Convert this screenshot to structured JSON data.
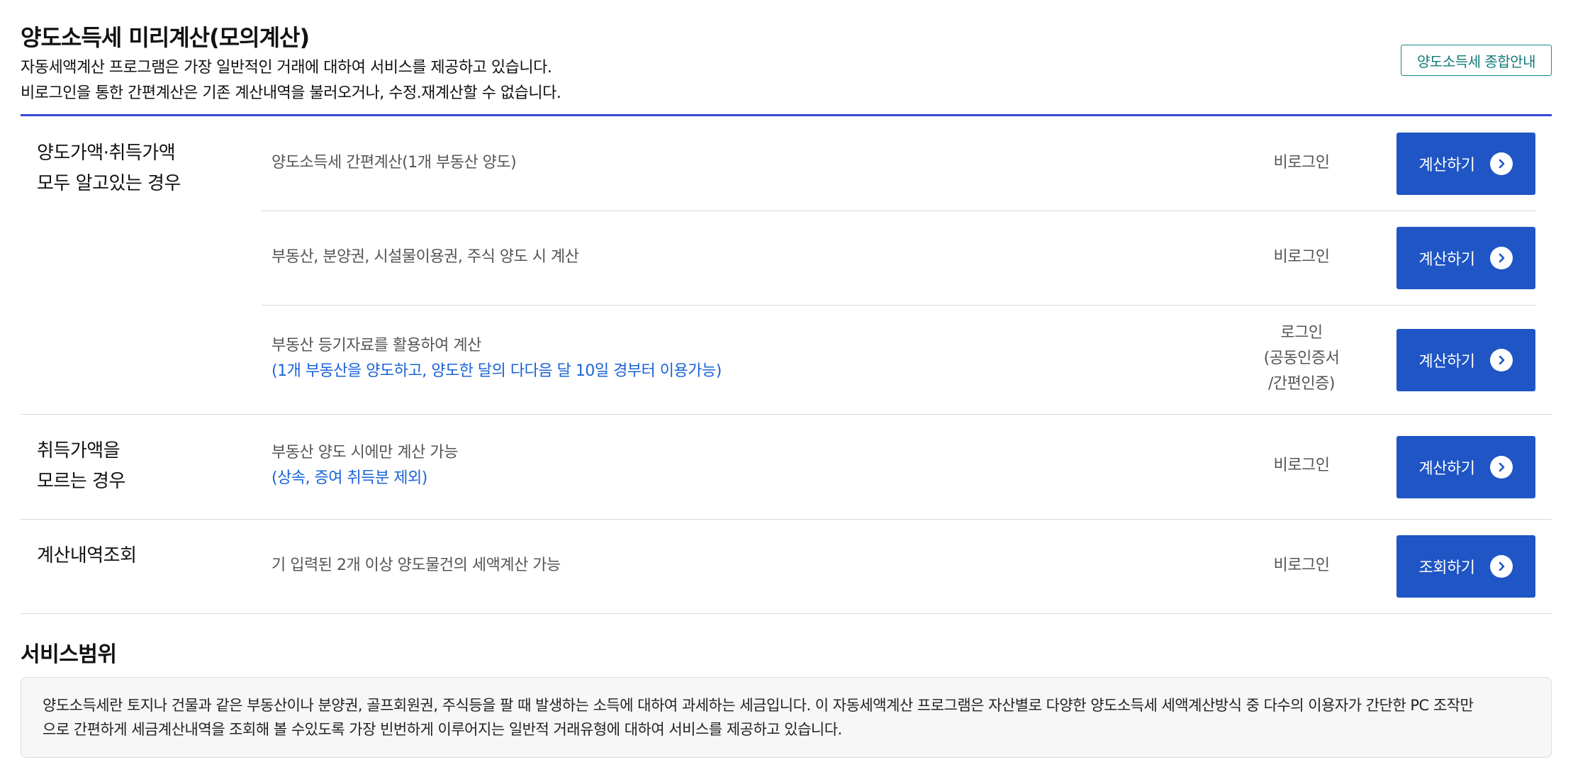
{
  "page": {
    "title": "양도소득세 미리계산(모의계산)",
    "intro_line1": "자동세액계산 프로그램은 가장 일반적인 거래에 대하여 서비스를 제공하고 있습니다.",
    "intro_line2": "비로그인을 통한 간편계산은 기존 계산내역을 불러오거나, 수정.재계산할 수 없습니다.",
    "guide_button": "양도소득세 종합안내"
  },
  "groups": [
    {
      "title_line1": "양도가액·취득가액",
      "title_line2": "모두 알고있는 경우"
    },
    {
      "title_line1": "취득가액을",
      "title_line2": "모르는 경우"
    },
    {
      "title_line1": "계산내역조회",
      "title_line2": ""
    }
  ],
  "rows": [
    {
      "desc": "양도소득세 간편계산(1개 부동산 양도)",
      "note": "",
      "login": "비로그인",
      "button": "계산하기"
    },
    {
      "desc": "부동산, 분양권, 시설물이용권, 주식 양도 시 계산",
      "note": "",
      "login": "비로그인",
      "button": "계산하기"
    },
    {
      "desc": "부동산 등기자료를 활용하여 계산",
      "note": "(1개 부동산을 양도하고, 양도한 달의 다다음 달 10일 경부터 이용가능)",
      "login_line1": "로그인",
      "login_line2": "(공동인증서",
      "login_line3": "/간편인증)",
      "button": "계산하기"
    },
    {
      "desc": "부동산 양도 시에만 계산 가능",
      "note": "(상속, 증여 취득분 제외)",
      "login": "비로그인",
      "button": "계산하기"
    },
    {
      "desc": "기 입력된 2개 이상 양도물건의 세액계산 가능",
      "note": "",
      "login": "비로그인",
      "button": "조회하기"
    }
  ],
  "scope": {
    "title": "서비스범위",
    "text_line1": "양도소득세란 토지나 건물과 같은 부동산이나 분양권, 골프회원권, 주식등을 팔 때 발생하는 소득에 대하여 과세하는 세금입니다. 이 자동세액계산 프로그램은 자산별로 다양한 양도소득세 세액계산방식 중 다수의 이용자가 간단한 PC 조작만",
    "text_line2": "으로 간편하게 세금계산내역을 조회해 볼 수있도록 가장 빈번하게 이루어지는 일반적 거래유형에 대하여 서비스를 제공하고 있습니다."
  },
  "colors": {
    "accent_rule": "#3a46d8",
    "button_bg": "#1f55c4",
    "note_text": "#1a63d6",
    "guide_border": "#1a8a8a"
  },
  "icons": {
    "button_arrow": "chevron-right-circle-icon"
  }
}
